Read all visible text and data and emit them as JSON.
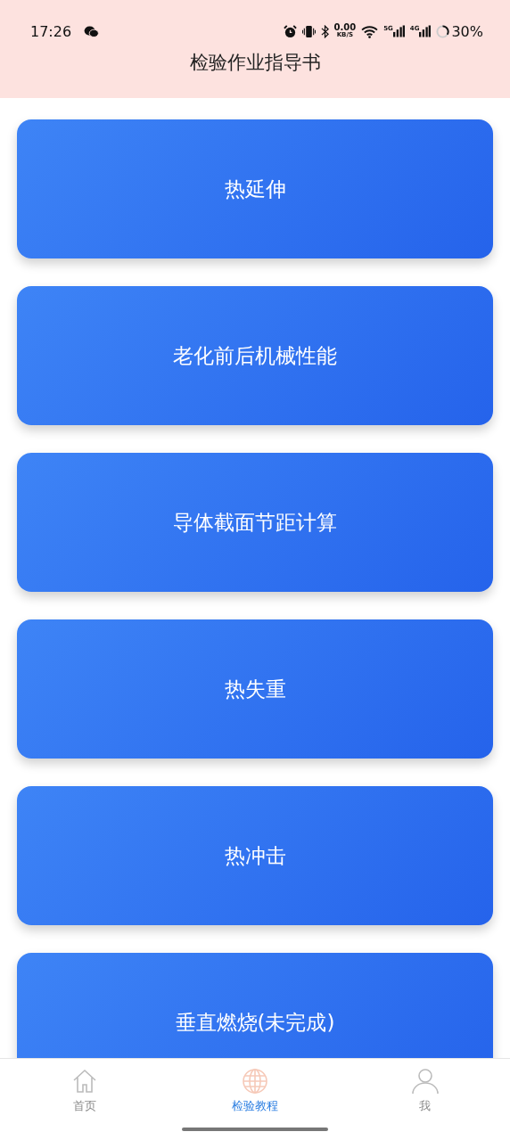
{
  "status_bar": {
    "time": "17:26",
    "speed": "0.00",
    "speed_unit": "KB/S",
    "network_1": "5G",
    "network_2": "4G",
    "battery": "30%"
  },
  "header": {
    "title": "检验作业指导书"
  },
  "items": [
    {
      "label": "热延伸"
    },
    {
      "label": "老化前后机械性能"
    },
    {
      "label": "导体截面节距计算"
    },
    {
      "label": "热失重"
    },
    {
      "label": "热冲击"
    },
    {
      "label": "垂直燃烧(未完成)"
    }
  ],
  "tab_bar": [
    {
      "kind": "home",
      "label": "首页",
      "selected": false
    },
    {
      "kind": "globe",
      "label": "检验教程",
      "selected": true
    },
    {
      "kind": "person",
      "label": "我",
      "selected": false
    }
  ]
}
